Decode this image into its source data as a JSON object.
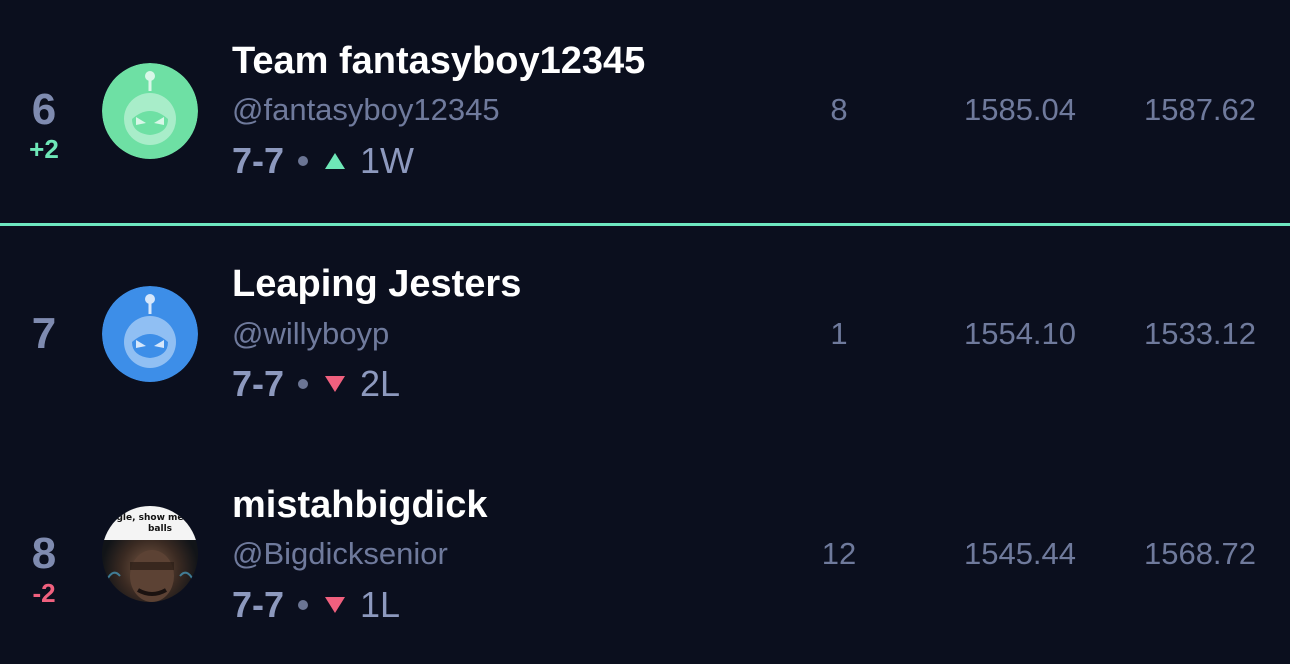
{
  "rows": [
    {
      "rank": "6",
      "rank_change": "+2",
      "team_name": "Team fantasyboy12345",
      "handle": "@fantasyboy12345",
      "record": "7-7",
      "streak": "1W",
      "streak_direction": "up",
      "col_1": "8",
      "col_2": "1585.04",
      "col_3": "1587.62",
      "avatar": "green-robot-avatar"
    },
    {
      "rank": "7",
      "rank_change": "",
      "team_name": "Leaping Jesters",
      "handle": "@willyboyp",
      "record": "7-7",
      "streak": "2L",
      "streak_direction": "down",
      "col_1": "1",
      "col_2": "1554.10",
      "col_3": "1533.12",
      "avatar": "blue-robot-avatar"
    },
    {
      "rank": "8",
      "rank_change": "-2",
      "team_name": "mistahbigdick",
      "handle": "@Bigdicksenior",
      "record": "7-7",
      "streak": "1L",
      "streak_direction": "down",
      "col_1": "12",
      "col_2": "1545.44",
      "col_3": "1568.72",
      "avatar": "photo-avatar",
      "avatar_caption": "gle, show me balls"
    }
  ],
  "colors": {
    "background": "#0b0f1e",
    "divider": "#6ee7c0",
    "up": "#6ee7b7",
    "down": "#f0607e",
    "avatar_green": "#6ee0a4",
    "avatar_blue": "#3d8ee8"
  }
}
